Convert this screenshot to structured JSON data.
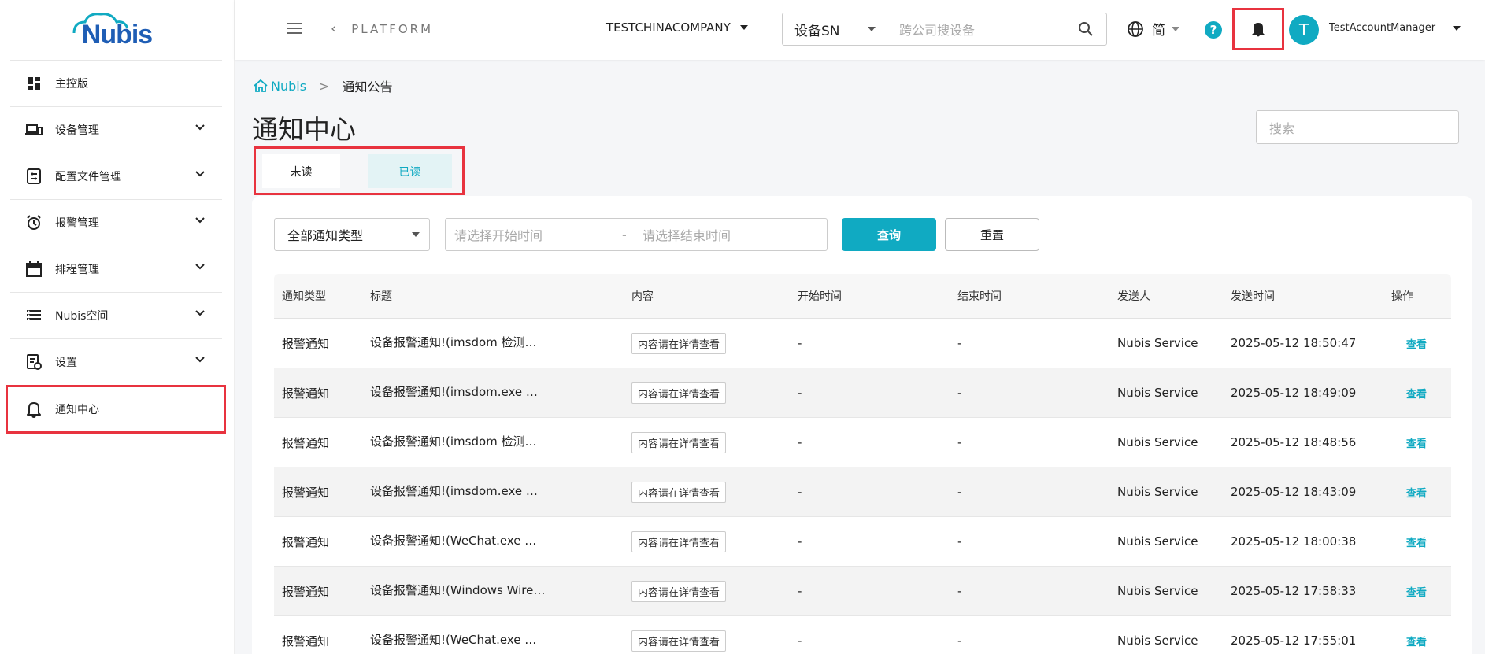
{
  "brand": {
    "logo_text": "Nubis",
    "accent": "#10aac2",
    "highlight": "#e8333f"
  },
  "sidebar": {
    "items": [
      {
        "label": "主控版",
        "icon": "dashboard-icon",
        "expandable": false
      },
      {
        "label": "设备管理",
        "icon": "devices-icon",
        "expandable": true
      },
      {
        "label": "配置文件管理",
        "icon": "config-file-icon",
        "expandable": true
      },
      {
        "label": "报警管理",
        "icon": "alarm-clock-icon",
        "expandable": true
      },
      {
        "label": "排程管理",
        "icon": "calendar-icon",
        "expandable": true
      },
      {
        "label": "Nubis空间",
        "icon": "storage-icon",
        "expandable": true
      },
      {
        "label": "设置",
        "icon": "settings-doc-icon",
        "expandable": true
      },
      {
        "label": "通知中心",
        "icon": "bell-outline-icon",
        "expandable": false,
        "active": true
      }
    ]
  },
  "header": {
    "back_label": "PLATFORM",
    "company": "TESTCHINACOMPANY",
    "search_type": "设备SN",
    "search_placeholder": "跨公司搜设备",
    "language": "简",
    "help": "?",
    "avatar_initial": "T",
    "account_name": "TestAccountManager"
  },
  "breadcrumb": {
    "home": "Nubis",
    "separator": ">",
    "current": "通知公告"
  },
  "page": {
    "title": "通知中心",
    "search_placeholder": "搜索",
    "tabs": {
      "unread": "未读",
      "read": "已读"
    }
  },
  "filters": {
    "type_value": "全部通知类型",
    "start_placeholder": "请选择开始时间",
    "dash": "-",
    "end_placeholder": "请选择结束时间",
    "query": "查询",
    "reset": "重置"
  },
  "table": {
    "columns": [
      "通知类型",
      "标题",
      "内容",
      "开始时间",
      "结束时间",
      "发送人",
      "发送时间",
      "操作"
    ],
    "rows": [
      {
        "type": "报警通知",
        "title": "设备报警通知!(imsdom 检测…",
        "content": "内容请在详情查看",
        "start": "-",
        "end": "-",
        "sender": "Nubis Service",
        "sent": "2025-05-12 18:50:47",
        "action": "查看"
      },
      {
        "type": "报警通知",
        "title": "设备报警通知!(imsdom.exe …",
        "content": "内容请在详情查看",
        "start": "-",
        "end": "-",
        "sender": "Nubis Service",
        "sent": "2025-05-12 18:49:09",
        "action": "查看"
      },
      {
        "type": "报警通知",
        "title": "设备报警通知!(imsdom 检测…",
        "content": "内容请在详情查看",
        "start": "-",
        "end": "-",
        "sender": "Nubis Service",
        "sent": "2025-05-12 18:48:56",
        "action": "查看"
      },
      {
        "type": "报警通知",
        "title": "设备报警通知!(imsdom.exe …",
        "content": "内容请在详情查看",
        "start": "-",
        "end": "-",
        "sender": "Nubis Service",
        "sent": "2025-05-12 18:43:09",
        "action": "查看"
      },
      {
        "type": "报警通知",
        "title": "设备报警通知!(WeChat.exe …",
        "content": "内容请在详情查看",
        "start": "-",
        "end": "-",
        "sender": "Nubis Service",
        "sent": "2025-05-12 18:00:38",
        "action": "查看"
      },
      {
        "type": "报警通知",
        "title": "设备报警通知!(Windows Wire…",
        "content": "内容请在详情查看",
        "start": "-",
        "end": "-",
        "sender": "Nubis Service",
        "sent": "2025-05-12 17:58:33",
        "action": "查看"
      },
      {
        "type": "报警通知",
        "title": "设备报警通知!(WeChat.exe …",
        "content": "内容请在详情查看",
        "start": "-",
        "end": "-",
        "sender": "Nubis Service",
        "sent": "2025-05-12 17:55:01",
        "action": "查看"
      }
    ]
  }
}
